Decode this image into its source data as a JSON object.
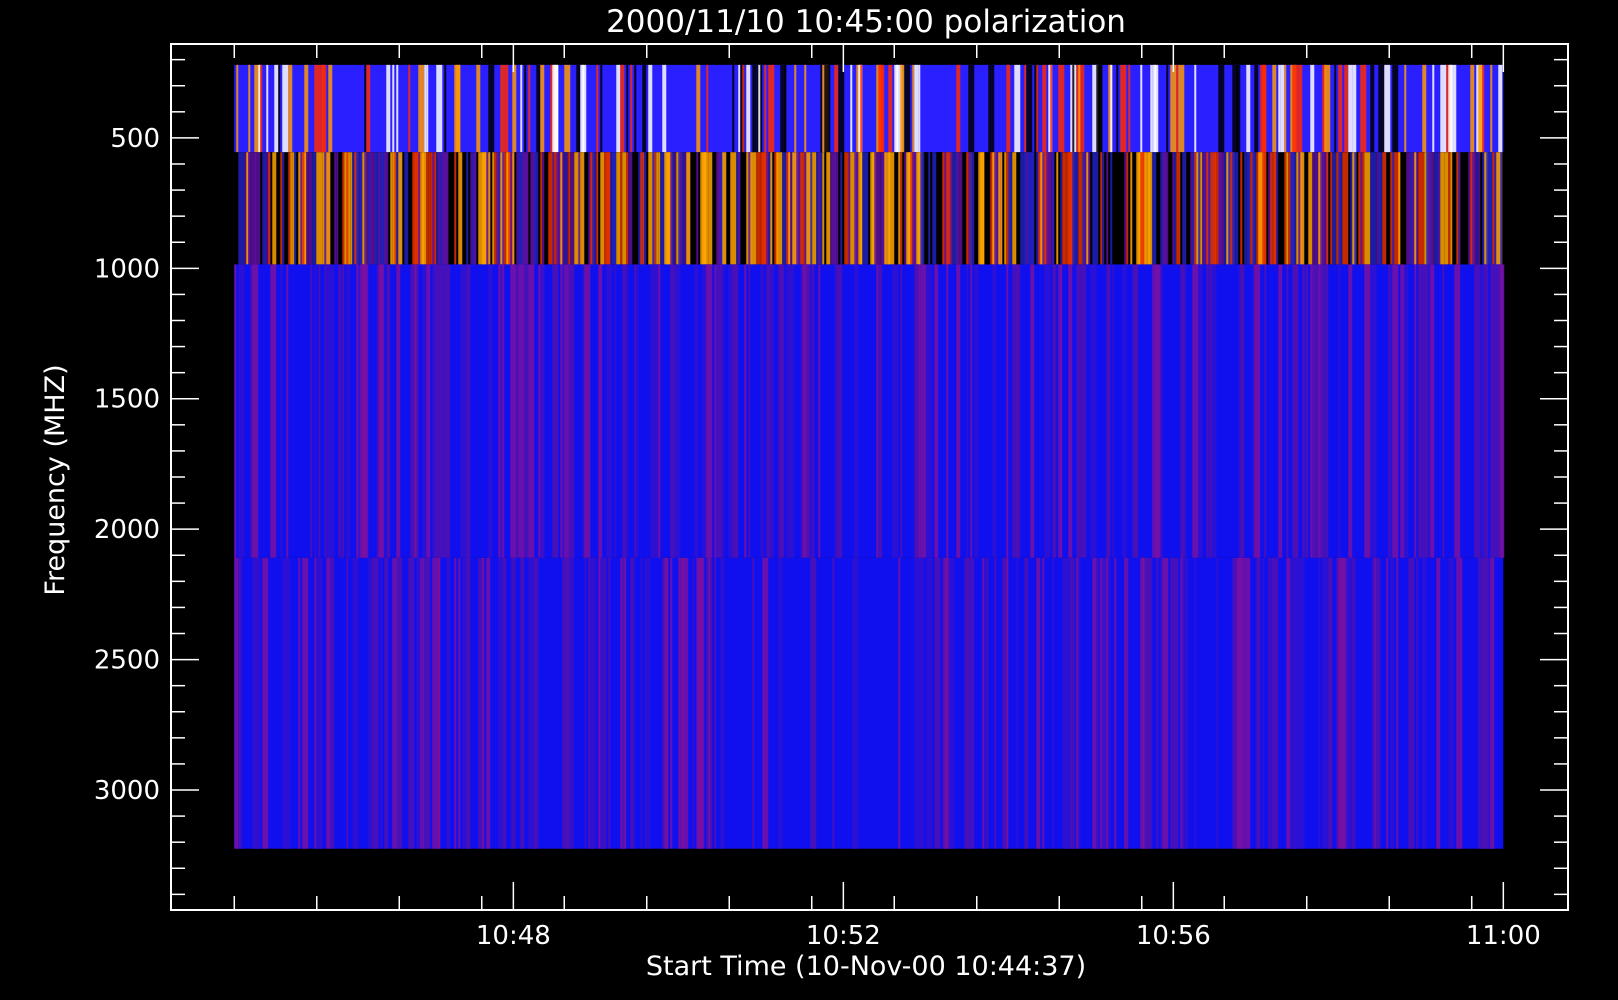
{
  "chart_data": {
    "type": "heatmap",
    "title": "2000/11/10 10:45:00 polarization",
    "xlabel": "Start Time (10-Nov-00 10:44:37)",
    "ylabel": "Frequency (MHZ)",
    "x_tick_labels": [
      "10:48",
      "10:52",
      "10:56",
      "11:00"
    ],
    "y_tick_labels": [
      "500",
      "1000",
      "1500",
      "2000",
      "2500",
      "3000"
    ],
    "x_ticks": [
      {
        "label": "10:48",
        "minutes": 3.383
      },
      {
        "label": "10:52",
        "minutes": 7.383
      },
      {
        "label": "10:56",
        "minutes": 11.383
      },
      {
        "label": "11:00",
        "minutes": 15.383
      }
    ],
    "x_range_minutes_from_start": [
      -0.767,
      16.167
    ],
    "data_x_range_minutes_from_start": [
      0,
      15.383
    ],
    "y_ticks": [
      500,
      1000,
      1500,
      2000,
      2500,
      3000
    ],
    "y_range_mhz": [
      3460,
      140
    ],
    "data_y_range_mhz": [
      3225,
      220
    ],
    "y_minor_step_mhz": 100,
    "x_minor_step_minutes": 1,
    "bands": [
      {
        "name": "band-low",
        "from_mhz": 220,
        "to_mhz": 555,
        "base_color": "#2a20ff",
        "stripe_colors": [
          "#ff2a00",
          "#ff9a00",
          "#ffffff",
          "#000000"
        ],
        "stripe_density": 0.28
      },
      {
        "name": "band-mid",
        "from_mhz": 555,
        "to_mhz": 985,
        "base_color": "#000000",
        "stripe_colors": [
          "#ffa500",
          "#e63000",
          "#5a10a0",
          "#2020c0"
        ],
        "stripe_density": 0.6
      },
      {
        "name": "band-high-1",
        "from_mhz": 985,
        "to_mhz": 2110,
        "base_color": "#1010ee",
        "stripe_colors": [
          "#5010b0",
          "#7a10a0",
          "#3010d0"
        ],
        "stripe_density": 0.3
      },
      {
        "name": "band-high-2",
        "from_mhz": 2110,
        "to_mhz": 3225,
        "base_color": "#1010ee",
        "stripe_colors": [
          "#5010b0",
          "#7a10a0",
          "#3010d0"
        ],
        "stripe_density": 0.3
      }
    ],
    "colors": {
      "background": "#000000",
      "axis": "#ffffff",
      "blue": "#1010ee",
      "orange": "#ffa500",
      "red": "#e63000",
      "purple": "#5a10a0"
    }
  }
}
